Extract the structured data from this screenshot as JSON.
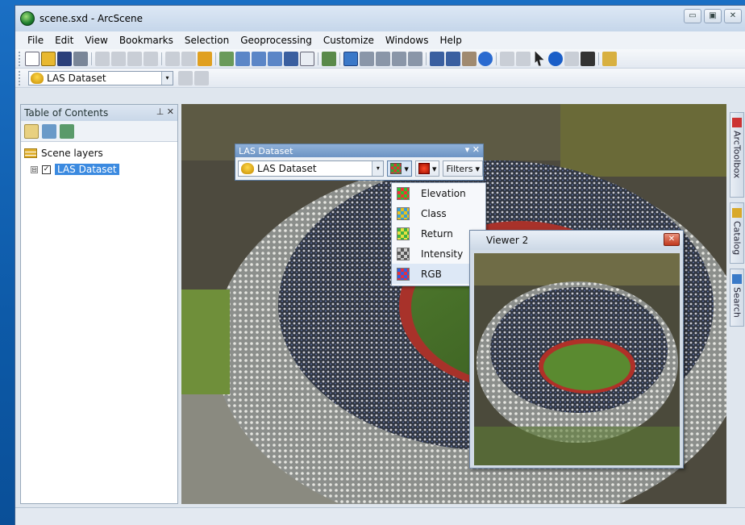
{
  "window": {
    "title": "scene.sxd - ArcScene",
    "controls": [
      "▭",
      "▣",
      "✕"
    ]
  },
  "menubar": [
    "File",
    "Edit",
    "View",
    "Bookmarks",
    "Selection",
    "Geoprocessing",
    "Customize",
    "Windows",
    "Help"
  ],
  "toolbar2": {
    "layer_select": "LAS Dataset"
  },
  "toc": {
    "title": "Table of Contents",
    "header_controls": "⊥ ✕",
    "items": [
      {
        "label": "Scene layers"
      },
      {
        "label": "LAS Dataset",
        "checked": true,
        "expander": "⊟",
        "check_mark": "✓"
      }
    ]
  },
  "las_toolbar": {
    "title": "LAS Dataset",
    "title_controls": "▾ ✕",
    "select_value": "LAS Dataset",
    "filters_label": "Filters",
    "dropdown_glyph": "▾"
  },
  "renderer_menu": [
    "Elevation",
    "Class",
    "Return",
    "Intensity",
    "RGB"
  ],
  "viewer2": {
    "title": "Viewer 2",
    "close": "✕"
  },
  "dock_tabs": [
    "ArcToolbox",
    "Catalog",
    "Search"
  ],
  "colors": {
    "titlebar": "#c5d6ea",
    "selection": "#3b8ae0",
    "desktop": "#0d5aa8"
  }
}
